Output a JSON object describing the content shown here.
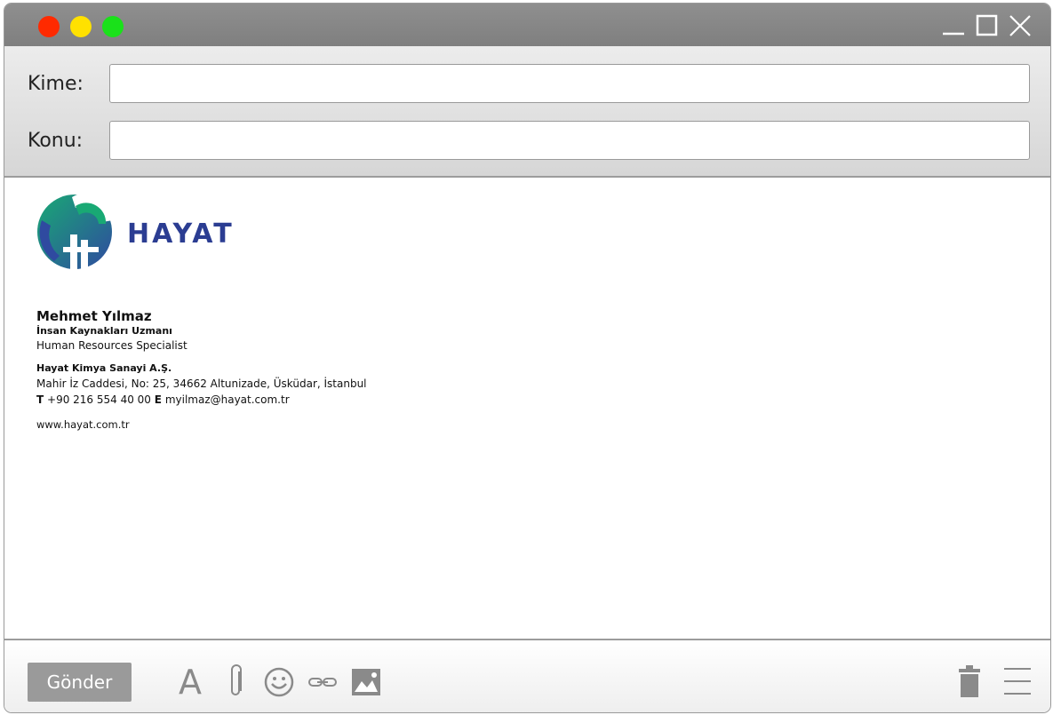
{
  "window": {
    "controls": {
      "close_color": "#ff2a00",
      "minimize_color": "#ffe100",
      "zoom_color": "#1ae11a"
    },
    "icons": [
      "minimize-icon",
      "maximize-icon",
      "close-icon"
    ]
  },
  "compose": {
    "to_label": "Kime:",
    "to_value": "",
    "subject_label": "Konu:",
    "subject_value": ""
  },
  "signature": {
    "brand": "HAYAT",
    "brand_color": "#2b3d92",
    "name": "Mehmet Yılmaz",
    "title_tr": "İnsan Kaynakları Uzmanı",
    "title_en": "Human Resources Specialist",
    "company": "Hayat Kimya Sanayi A.Ş.",
    "address": "Mahir İz Caddesi, No: 25, 34662 Altunizade, Üsküdar, İstanbul",
    "phone_label": "T",
    "phone": "+90 216 554 40 00",
    "email_label": "E",
    "email": "myilmaz@hayat.com.tr",
    "website": "www.hayat.com.tr"
  },
  "toolbar": {
    "send_label": "Gönder",
    "font_glyph": "A",
    "tools": [
      "font-icon",
      "attachment-icon",
      "emoji-icon",
      "link-icon",
      "image-icon",
      "trash-icon",
      "menu-icon"
    ]
  }
}
